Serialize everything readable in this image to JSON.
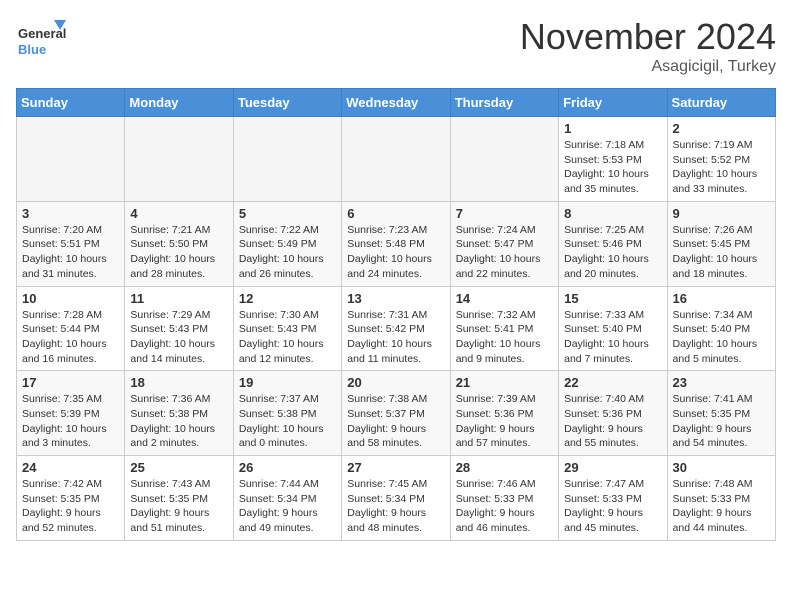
{
  "header": {
    "logo_general": "General",
    "logo_blue": "Blue",
    "month_title": "November 2024",
    "location": "Asagicigil, Turkey"
  },
  "weekdays": [
    "Sunday",
    "Monday",
    "Tuesday",
    "Wednesday",
    "Thursday",
    "Friday",
    "Saturday"
  ],
  "weeks": [
    [
      {
        "day": "",
        "info": ""
      },
      {
        "day": "",
        "info": ""
      },
      {
        "day": "",
        "info": ""
      },
      {
        "day": "",
        "info": ""
      },
      {
        "day": "",
        "info": ""
      },
      {
        "day": "1",
        "info": "Sunrise: 7:18 AM\nSunset: 5:53 PM\nDaylight: 10 hours and 35 minutes."
      },
      {
        "day": "2",
        "info": "Sunrise: 7:19 AM\nSunset: 5:52 PM\nDaylight: 10 hours and 33 minutes."
      }
    ],
    [
      {
        "day": "3",
        "info": "Sunrise: 7:20 AM\nSunset: 5:51 PM\nDaylight: 10 hours and 31 minutes."
      },
      {
        "day": "4",
        "info": "Sunrise: 7:21 AM\nSunset: 5:50 PM\nDaylight: 10 hours and 28 minutes."
      },
      {
        "day": "5",
        "info": "Sunrise: 7:22 AM\nSunset: 5:49 PM\nDaylight: 10 hours and 26 minutes."
      },
      {
        "day": "6",
        "info": "Sunrise: 7:23 AM\nSunset: 5:48 PM\nDaylight: 10 hours and 24 minutes."
      },
      {
        "day": "7",
        "info": "Sunrise: 7:24 AM\nSunset: 5:47 PM\nDaylight: 10 hours and 22 minutes."
      },
      {
        "day": "8",
        "info": "Sunrise: 7:25 AM\nSunset: 5:46 PM\nDaylight: 10 hours and 20 minutes."
      },
      {
        "day": "9",
        "info": "Sunrise: 7:26 AM\nSunset: 5:45 PM\nDaylight: 10 hours and 18 minutes."
      }
    ],
    [
      {
        "day": "10",
        "info": "Sunrise: 7:28 AM\nSunset: 5:44 PM\nDaylight: 10 hours and 16 minutes."
      },
      {
        "day": "11",
        "info": "Sunrise: 7:29 AM\nSunset: 5:43 PM\nDaylight: 10 hours and 14 minutes."
      },
      {
        "day": "12",
        "info": "Sunrise: 7:30 AM\nSunset: 5:43 PM\nDaylight: 10 hours and 12 minutes."
      },
      {
        "day": "13",
        "info": "Sunrise: 7:31 AM\nSunset: 5:42 PM\nDaylight: 10 hours and 11 minutes."
      },
      {
        "day": "14",
        "info": "Sunrise: 7:32 AM\nSunset: 5:41 PM\nDaylight: 10 hours and 9 minutes."
      },
      {
        "day": "15",
        "info": "Sunrise: 7:33 AM\nSunset: 5:40 PM\nDaylight: 10 hours and 7 minutes."
      },
      {
        "day": "16",
        "info": "Sunrise: 7:34 AM\nSunset: 5:40 PM\nDaylight: 10 hours and 5 minutes."
      }
    ],
    [
      {
        "day": "17",
        "info": "Sunrise: 7:35 AM\nSunset: 5:39 PM\nDaylight: 10 hours and 3 minutes."
      },
      {
        "day": "18",
        "info": "Sunrise: 7:36 AM\nSunset: 5:38 PM\nDaylight: 10 hours and 2 minutes."
      },
      {
        "day": "19",
        "info": "Sunrise: 7:37 AM\nSunset: 5:38 PM\nDaylight: 10 hours and 0 minutes."
      },
      {
        "day": "20",
        "info": "Sunrise: 7:38 AM\nSunset: 5:37 PM\nDaylight: 9 hours and 58 minutes."
      },
      {
        "day": "21",
        "info": "Sunrise: 7:39 AM\nSunset: 5:36 PM\nDaylight: 9 hours and 57 minutes."
      },
      {
        "day": "22",
        "info": "Sunrise: 7:40 AM\nSunset: 5:36 PM\nDaylight: 9 hours and 55 minutes."
      },
      {
        "day": "23",
        "info": "Sunrise: 7:41 AM\nSunset: 5:35 PM\nDaylight: 9 hours and 54 minutes."
      }
    ],
    [
      {
        "day": "24",
        "info": "Sunrise: 7:42 AM\nSunset: 5:35 PM\nDaylight: 9 hours and 52 minutes."
      },
      {
        "day": "25",
        "info": "Sunrise: 7:43 AM\nSunset: 5:35 PM\nDaylight: 9 hours and 51 minutes."
      },
      {
        "day": "26",
        "info": "Sunrise: 7:44 AM\nSunset: 5:34 PM\nDaylight: 9 hours and 49 minutes."
      },
      {
        "day": "27",
        "info": "Sunrise: 7:45 AM\nSunset: 5:34 PM\nDaylight: 9 hours and 48 minutes."
      },
      {
        "day": "28",
        "info": "Sunrise: 7:46 AM\nSunset: 5:33 PM\nDaylight: 9 hours and 46 minutes."
      },
      {
        "day": "29",
        "info": "Sunrise: 7:47 AM\nSunset: 5:33 PM\nDaylight: 9 hours and 45 minutes."
      },
      {
        "day": "30",
        "info": "Sunrise: 7:48 AM\nSunset: 5:33 PM\nDaylight: 9 hours and 44 minutes."
      }
    ]
  ]
}
